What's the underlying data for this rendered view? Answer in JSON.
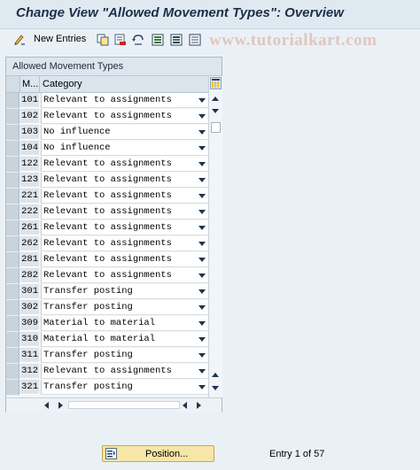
{
  "title": "Change View \"Allowed Movement Types\": Overview",
  "toolbar": {
    "new_entries_label": "New Entries",
    "icons": [
      "edit-pen-icon",
      "copy-icon",
      "delete-icon",
      "undo-icon",
      "select-all-icon",
      "select-block-icon",
      "deselect-all-icon"
    ]
  },
  "watermark": "www.tutorialkart.com",
  "table": {
    "title": "Allowed Movement Types",
    "columns": [
      "M...",
      "Category"
    ],
    "rows": [
      {
        "code": "101",
        "category": "Relevant to assignments"
      },
      {
        "code": "102",
        "category": "Relevant to assignments"
      },
      {
        "code": "103",
        "category": "No influence"
      },
      {
        "code": "104",
        "category": "No influence"
      },
      {
        "code": "122",
        "category": "Relevant to assignments"
      },
      {
        "code": "123",
        "category": "Relevant to assignments"
      },
      {
        "code": "221",
        "category": "Relevant to assignments"
      },
      {
        "code": "222",
        "category": "Relevant to assignments"
      },
      {
        "code": "261",
        "category": "Relevant to assignments"
      },
      {
        "code": "262",
        "category": "Relevant to assignments"
      },
      {
        "code": "281",
        "category": "Relevant to assignments"
      },
      {
        "code": "282",
        "category": "Relevant to assignments"
      },
      {
        "code": "301",
        "category": "Transfer posting"
      },
      {
        "code": "302",
        "category": "Transfer posting"
      },
      {
        "code": "309",
        "category": "Material to material"
      },
      {
        "code": "310",
        "category": "Material to material"
      },
      {
        "code": "311",
        "category": "Transfer posting"
      },
      {
        "code": "312",
        "category": "Relevant to assignments"
      },
      {
        "code": "321",
        "category": "Transfer posting"
      }
    ]
  },
  "footer": {
    "position_label": "Position...",
    "entry_text": "Entry 1 of 57"
  },
  "colors": {
    "title": "#1d2f4a",
    "position_button_bg": "#f6e6a7",
    "watermark": "#e3c5bd"
  }
}
